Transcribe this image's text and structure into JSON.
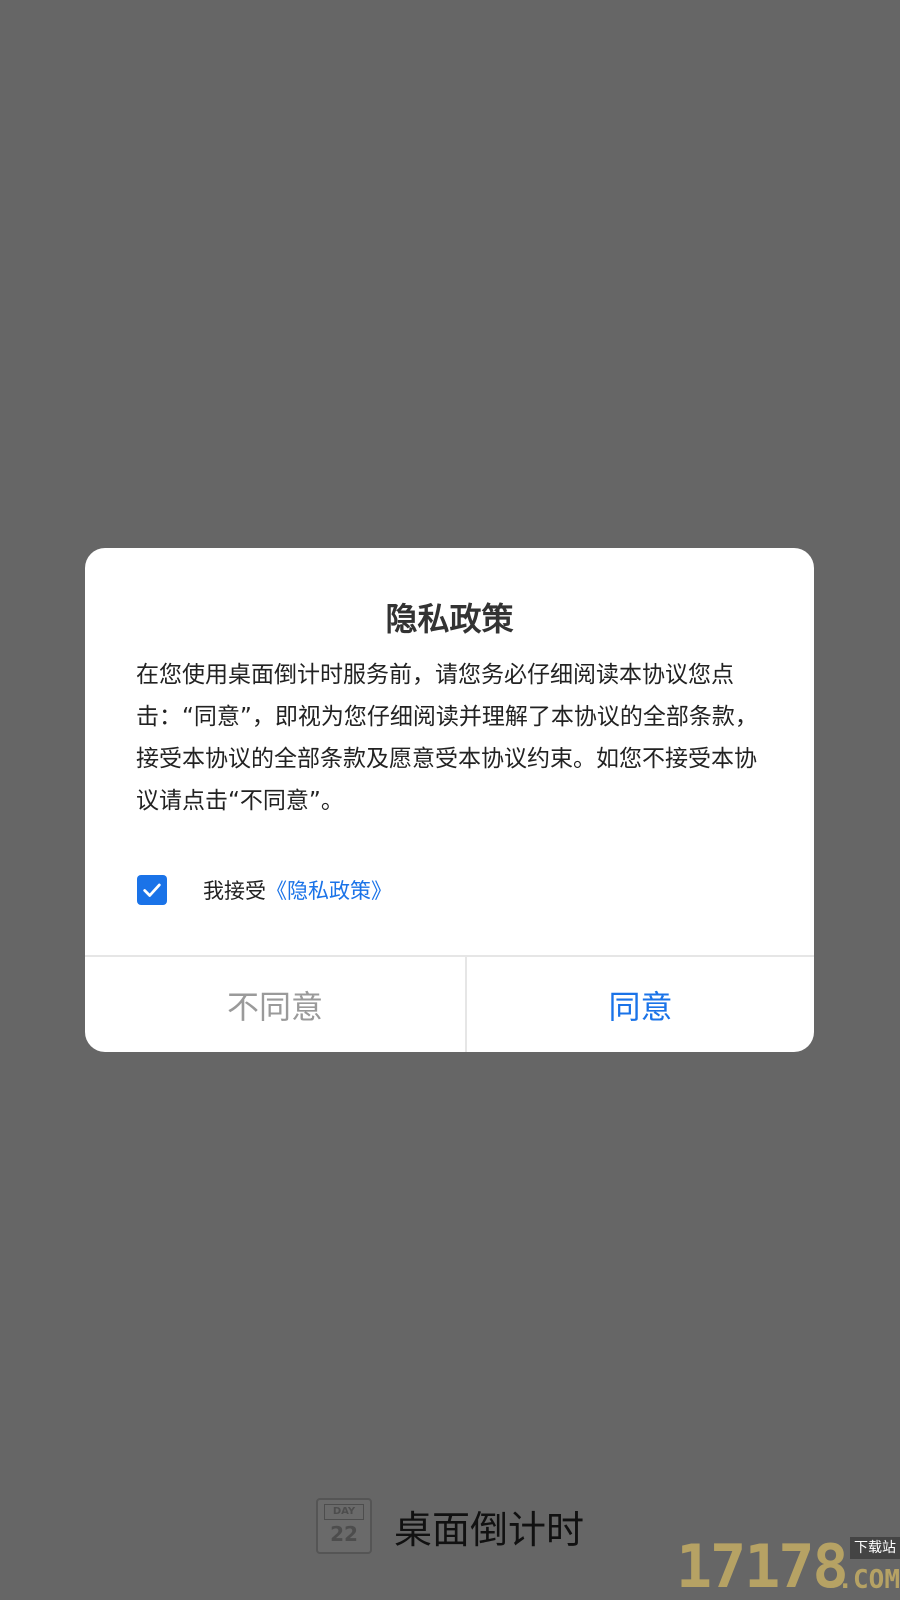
{
  "splash": {
    "app_name": "桌面倒计时",
    "logo_top": "DAY",
    "logo_number": "22"
  },
  "dialog": {
    "title": "隐私政策",
    "body": "在您使用桌面倒计时服务前，请您务必仔细阅读本协议您点击：“同意”，即视为您仔细阅读并理解了本协议的全部条款，接受本协议的全部条款及愿意受本协议约束。如您不接受本协议请点击“不同意”。",
    "consent_checked": true,
    "consent_prefix": "我接受",
    "consent_link": "《隐私政策》",
    "disagree_label": "不同意",
    "agree_label": "同意"
  },
  "watermark": {
    "digits": "17178",
    "badge": "下载站",
    "suffix": ".COM"
  },
  "colors": {
    "accent": "#1a73e8",
    "overlay": "rgba(0,0,0,0.6)",
    "disabled_text": "#9a9a9a"
  },
  "icons": {
    "checkbox": "check-icon"
  }
}
